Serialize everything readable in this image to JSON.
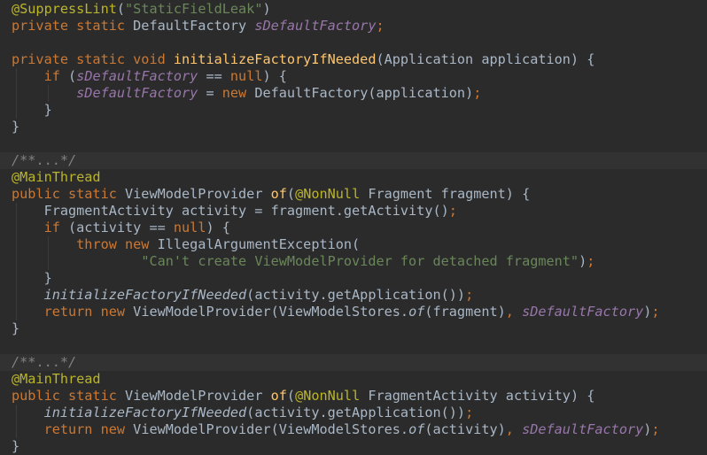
{
  "editor": {
    "theme_colors": {
      "background": "#2b2b2b",
      "folded_background": "#323232",
      "default_text": "#a9b7c6",
      "keyword": "#cc7832",
      "annotation": "#bbb529",
      "string": "#6a8759",
      "field": "#9876aa",
      "method_declaration": "#ffc66d",
      "comment": "#808080"
    },
    "lines": [
      {
        "guides": [],
        "tokens": [
          [
            "ann",
            "@SuppressLint"
          ],
          [
            "p",
            "("
          ],
          [
            "str",
            "\"StaticFieldLeak\""
          ],
          [
            "p",
            ")"
          ]
        ]
      },
      {
        "guides": [],
        "tokens": [
          [
            "kw",
            "private static "
          ],
          [
            "p",
            "DefaultFactory "
          ],
          [
            "fld",
            "sDefaultFactory"
          ],
          [
            "kw",
            ";"
          ]
        ]
      },
      {
        "guides": [],
        "tokens": []
      },
      {
        "guides": [],
        "tokens": [
          [
            "kw",
            "private static void "
          ],
          [
            "fn",
            "initializeFactoryIfNeeded"
          ],
          [
            "p",
            "(Application application) {"
          ]
        ]
      },
      {
        "guides": [
          1
        ],
        "tokens": [
          [
            "p",
            "    "
          ],
          [
            "kw",
            "if "
          ],
          [
            "p",
            "("
          ],
          [
            "fld",
            "sDefaultFactory"
          ],
          [
            "p",
            " == "
          ],
          [
            "kw",
            "null"
          ],
          [
            "p",
            ") {"
          ]
        ]
      },
      {
        "guides": [
          1,
          2
        ],
        "tokens": [
          [
            "p",
            "        "
          ],
          [
            "fld",
            "sDefaultFactory"
          ],
          [
            "p",
            " = "
          ],
          [
            "kw",
            "new "
          ],
          [
            "p",
            "DefaultFactory(application)"
          ],
          [
            "kw",
            ";"
          ]
        ]
      },
      {
        "guides": [
          1
        ],
        "tokens": [
          [
            "p",
            "    }"
          ]
        ]
      },
      {
        "guides": [],
        "tokens": [
          [
            "p",
            "}"
          ]
        ]
      },
      {
        "guides": [],
        "tokens": []
      },
      {
        "guides": [],
        "folded": true,
        "tokens": [
          [
            "cmt",
            "/**"
          ],
          [
            "fold",
            "..."
          ],
          [
            "cmt",
            "*/"
          ]
        ]
      },
      {
        "guides": [],
        "tokens": [
          [
            "ann",
            "@MainThread"
          ]
        ]
      },
      {
        "guides": [],
        "tokens": [
          [
            "kw",
            "public static "
          ],
          [
            "p",
            "ViewModelProvider "
          ],
          [
            "fn",
            "of"
          ],
          [
            "p",
            "("
          ],
          [
            "ann",
            "@NonNull "
          ],
          [
            "p",
            "Fragment fragment) {"
          ]
        ]
      },
      {
        "guides": [
          1
        ],
        "tokens": [
          [
            "p",
            "    FragmentActivity activity = fragment.getActivity()"
          ],
          [
            "kw",
            ";"
          ]
        ]
      },
      {
        "guides": [
          1
        ],
        "tokens": [
          [
            "p",
            "    "
          ],
          [
            "kw",
            "if "
          ],
          [
            "p",
            "(activity == "
          ],
          [
            "kw",
            "null"
          ],
          [
            "p",
            ") {"
          ]
        ]
      },
      {
        "guides": [
          1,
          2
        ],
        "tokens": [
          [
            "p",
            "        "
          ],
          [
            "kw",
            "throw new "
          ],
          [
            "p",
            "IllegalArgumentException("
          ]
        ]
      },
      {
        "guides": [
          1,
          2
        ],
        "tokens": [
          [
            "p",
            "                "
          ],
          [
            "str",
            "\"Can't create ViewModelProvider for detached fragment\""
          ],
          [
            "p",
            ")"
          ],
          [
            "kw",
            ";"
          ]
        ]
      },
      {
        "guides": [
          1
        ],
        "tokens": [
          [
            "p",
            "    }"
          ]
        ]
      },
      {
        "guides": [
          1
        ],
        "tokens": [
          [
            "p",
            "    "
          ],
          [
            "it",
            "initializeFactoryIfNeeded"
          ],
          [
            "p",
            "(activity.getApplication())"
          ],
          [
            "kw",
            ";"
          ]
        ]
      },
      {
        "guides": [
          1
        ],
        "tokens": [
          [
            "p",
            "    "
          ],
          [
            "kw",
            "return new "
          ],
          [
            "p",
            "ViewModelProvider(ViewModelStores."
          ],
          [
            "it",
            "of"
          ],
          [
            "p",
            "(fragment)"
          ],
          [
            "kw",
            ", "
          ],
          [
            "fld",
            "sDefaultFactory"
          ],
          [
            "p",
            ")"
          ],
          [
            "kw",
            ";"
          ]
        ]
      },
      {
        "guides": [],
        "tokens": [
          [
            "p",
            "}"
          ]
        ]
      },
      {
        "guides": [],
        "tokens": []
      },
      {
        "guides": [],
        "folded": true,
        "tokens": [
          [
            "cmt",
            "/**"
          ],
          [
            "fold",
            "..."
          ],
          [
            "cmt",
            "*/"
          ]
        ]
      },
      {
        "guides": [],
        "tokens": [
          [
            "ann",
            "@MainThread"
          ]
        ]
      },
      {
        "guides": [],
        "tokens": [
          [
            "kw",
            "public static "
          ],
          [
            "p",
            "ViewModelProvider "
          ],
          [
            "fn",
            "of"
          ],
          [
            "p",
            "("
          ],
          [
            "ann",
            "@NonNull "
          ],
          [
            "p",
            "FragmentActivity activity) {"
          ]
        ]
      },
      {
        "guides": [
          1
        ],
        "tokens": [
          [
            "p",
            "    "
          ],
          [
            "it",
            "initializeFactoryIfNeeded"
          ],
          [
            "p",
            "(activity.getApplication())"
          ],
          [
            "kw",
            ";"
          ]
        ]
      },
      {
        "guides": [
          1
        ],
        "tokens": [
          [
            "p",
            "    "
          ],
          [
            "kw",
            "return new "
          ],
          [
            "p",
            "ViewModelProvider(ViewModelStores."
          ],
          [
            "it",
            "of"
          ],
          [
            "p",
            "(activity)"
          ],
          [
            "kw",
            ", "
          ],
          [
            "fld",
            "sDefaultFactory"
          ],
          [
            "p",
            ")"
          ],
          [
            "kw",
            ";"
          ]
        ]
      },
      {
        "guides": [],
        "tokens": [
          [
            "p",
            "}"
          ]
        ]
      }
    ]
  }
}
